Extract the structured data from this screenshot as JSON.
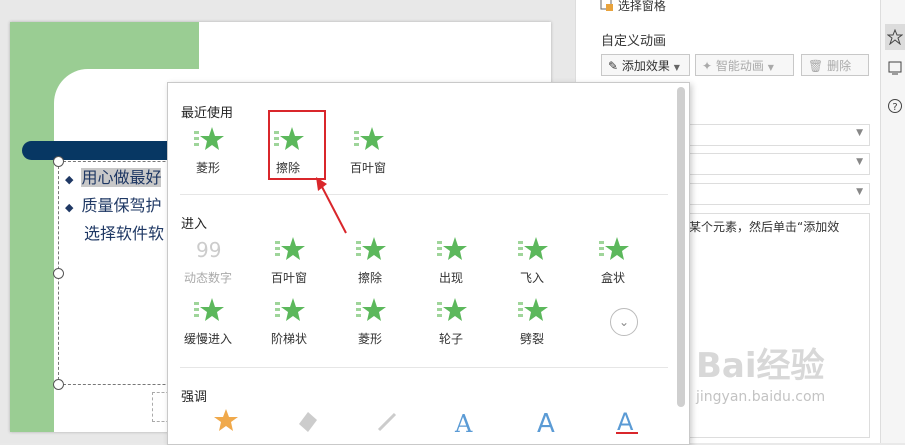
{
  "slide": {
    "bullets": [
      "用心做最好",
      "质量保驾护",
      "选择软件软"
    ]
  },
  "pane": {
    "selection_pane_label": "选择窗格",
    "custom_animation_label": "自定义动画",
    "add_effect_label": "添加效果",
    "smart_animation_label": "智能动画",
    "delete_label": "删除",
    "hint_text": "某个元素，然后单击“添加效"
  },
  "popup": {
    "recent_title": "最近使用",
    "recent": [
      {
        "label": "菱形",
        "icon": "diamond-effect-icon"
      },
      {
        "label": "擦除",
        "icon": "wipe-effect-icon"
      },
      {
        "label": "百叶窗",
        "icon": "blinds-effect-icon"
      }
    ],
    "enter_title": "进入",
    "enter": [
      {
        "label": "动态数字",
        "icon": "dynamic-number-effect-icon",
        "disabled": true
      },
      {
        "label": "百叶窗",
        "icon": "blinds-effect-icon"
      },
      {
        "label": "擦除",
        "icon": "wipe-effect-icon"
      },
      {
        "label": "出现",
        "icon": "appear-effect-icon"
      },
      {
        "label": "飞入",
        "icon": "fly-in-effect-icon"
      },
      {
        "label": "盒状",
        "icon": "box-effect-icon"
      },
      {
        "label": "缓慢进入",
        "icon": "crawl-in-effect-icon"
      },
      {
        "label": "阶梯状",
        "icon": "stairs-effect-icon"
      },
      {
        "label": "菱形",
        "icon": "diamond-effect-icon"
      },
      {
        "label": "轮子",
        "icon": "wheel-effect-icon"
      },
      {
        "label": "劈裂",
        "icon": "split-effect-icon"
      }
    ],
    "emphasis_title": "强调"
  },
  "watermark": {
    "brand": "Bai经验",
    "url": "jingyan.baidu.com"
  },
  "colors": {
    "slide_green": "#9acd93",
    "title_bar": "#073763",
    "highlight": "#d9262b",
    "star": "#5cb85c"
  }
}
